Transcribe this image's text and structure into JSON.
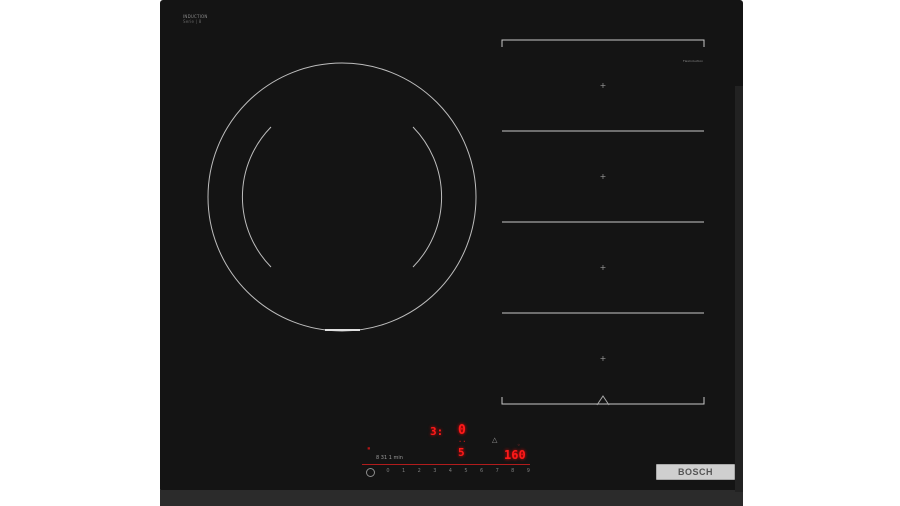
{
  "label": {
    "line1": "INDUCTION",
    "line2": "Serie | 8"
  },
  "brand": "BOSCH",
  "zone_tag": "FlexInduction",
  "displays": {
    "timer_small": "3:",
    "top_digit": "0",
    "mid_digit": "5",
    "right_display": "160",
    "zone_info": "8 31 1 min"
  },
  "scale_labels": [
    "0",
    "1",
    "2",
    "3",
    "4",
    "5",
    "6",
    "7",
    "8",
    "9"
  ],
  "colors": {
    "glass": "#141414",
    "display_red": "#ff1a1a",
    "brand_plate": "#cfcfcf"
  }
}
